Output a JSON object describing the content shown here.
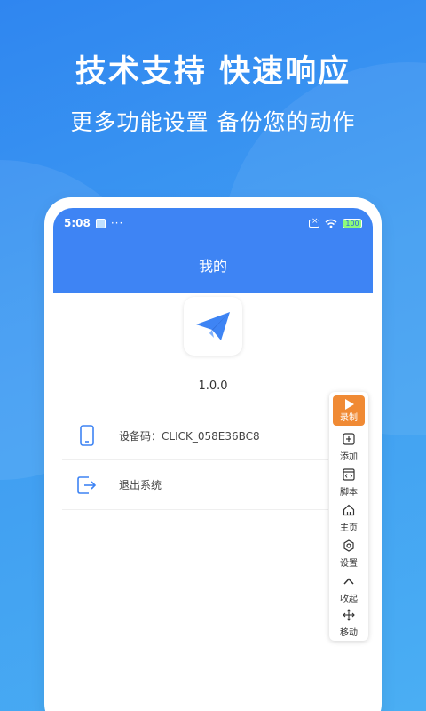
{
  "promo": {
    "headline": "技术支持 快速响应",
    "subheadline": "更多功能设置 备份您的动作"
  },
  "statusbar": {
    "time": "5:08",
    "dots": "···",
    "battery": "100"
  },
  "appbar": {
    "title": "我的"
  },
  "profile": {
    "logo_icon": "paper-plane-icon",
    "version": "1.0.0"
  },
  "menu": {
    "items": [
      {
        "label": "设备码：CLICK_058E36BC8",
        "icon": "phone-icon"
      },
      {
        "label": "退出系统",
        "icon": "logout-icon"
      }
    ]
  },
  "float_panel": {
    "record": "录制",
    "add": "添加",
    "script": "脚本",
    "home": "主页",
    "settings": "设置",
    "collapse": "收起",
    "move": "移动"
  },
  "colors": {
    "brand": "#3e84f4",
    "accent": "#f08a34",
    "background": "#3d93f0"
  }
}
